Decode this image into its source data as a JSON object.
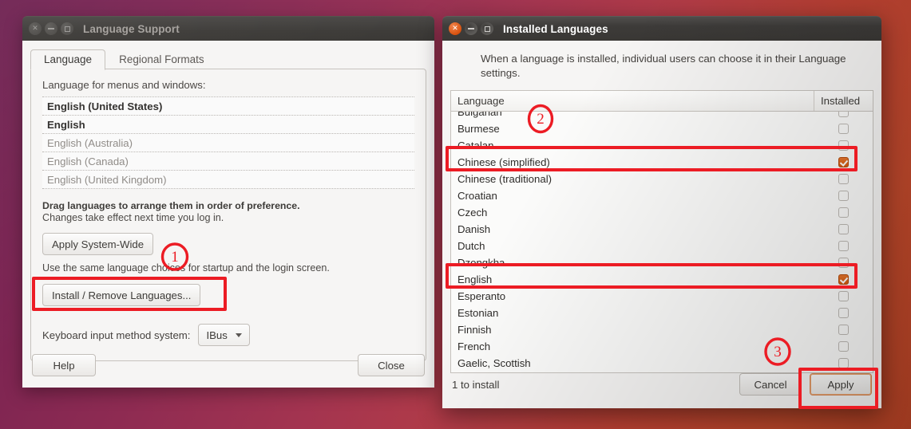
{
  "desktop": {
    "wallpaper_colors": [
      "#6d2050",
      "#a33450",
      "#c34a2c"
    ]
  },
  "accent_color": "#dd4814",
  "annotation_color": "#ec1c24",
  "language_window": {
    "title": "Language Support",
    "window_buttons": [
      "close",
      "minimize",
      "maximize"
    ],
    "tabs": [
      {
        "label": "Language",
        "selected": true
      },
      {
        "label": "Regional Formats",
        "selected": false
      }
    ],
    "list_label": "Language for menus and windows:",
    "languages": [
      {
        "name": "English (United States)",
        "style": "strong"
      },
      {
        "name": "English",
        "style": "strong"
      },
      {
        "name": "English (Australia)",
        "style": "dim"
      },
      {
        "name": "English (Canada)",
        "style": "dim"
      },
      {
        "name": "English (United Kingdom)",
        "style": "dim"
      }
    ],
    "drag_hint_bold": "Drag languages to arrange them in order of preference.",
    "drag_hint": "Changes take effect next time you log in.",
    "apply_system_wide_label": "Apply System-Wide",
    "system_wide_hint": "Use the same language choices for startup and the login screen.",
    "install_remove_label": "Install / Remove Languages...",
    "input_method_label": "Keyboard input method system:",
    "input_method_value": "IBus",
    "help_label": "Help",
    "close_label": "Close"
  },
  "installed_window": {
    "title": "Installed Languages",
    "window_buttons": [
      "close",
      "minimize",
      "maximize"
    ],
    "intro": "When a language is installed, individual users can choose it in their Language settings.",
    "columns": {
      "language": "Language",
      "installed": "Installed"
    },
    "rows": [
      {
        "name": "Bulgarian",
        "installed": false,
        "clipped": "top"
      },
      {
        "name": "Burmese",
        "installed": false
      },
      {
        "name": "Catalan",
        "installed": false
      },
      {
        "name": "Chinese (simplified)",
        "installed": true
      },
      {
        "name": "Chinese (traditional)",
        "installed": false
      },
      {
        "name": "Croatian",
        "installed": false
      },
      {
        "name": "Czech",
        "installed": false
      },
      {
        "name": "Danish",
        "installed": false
      },
      {
        "name": "Dutch",
        "installed": false
      },
      {
        "name": "Dzongkha",
        "installed": false
      },
      {
        "name": "English",
        "installed": true
      },
      {
        "name": "Esperanto",
        "installed": false
      },
      {
        "name": "Estonian",
        "installed": false
      },
      {
        "name": "Finnish",
        "installed": false
      },
      {
        "name": "French",
        "installed": false
      },
      {
        "name": "Gaelic, Scottish",
        "installed": false
      }
    ],
    "status": "1 to install",
    "cancel_label": "Cancel",
    "apply_label": "Apply"
  },
  "annotations": [
    {
      "number": "1",
      "target": "install-remove-languages-button"
    },
    {
      "number": "2",
      "target": "chinese-simplified-row"
    },
    {
      "number": "3",
      "target": "apply-button"
    }
  ]
}
